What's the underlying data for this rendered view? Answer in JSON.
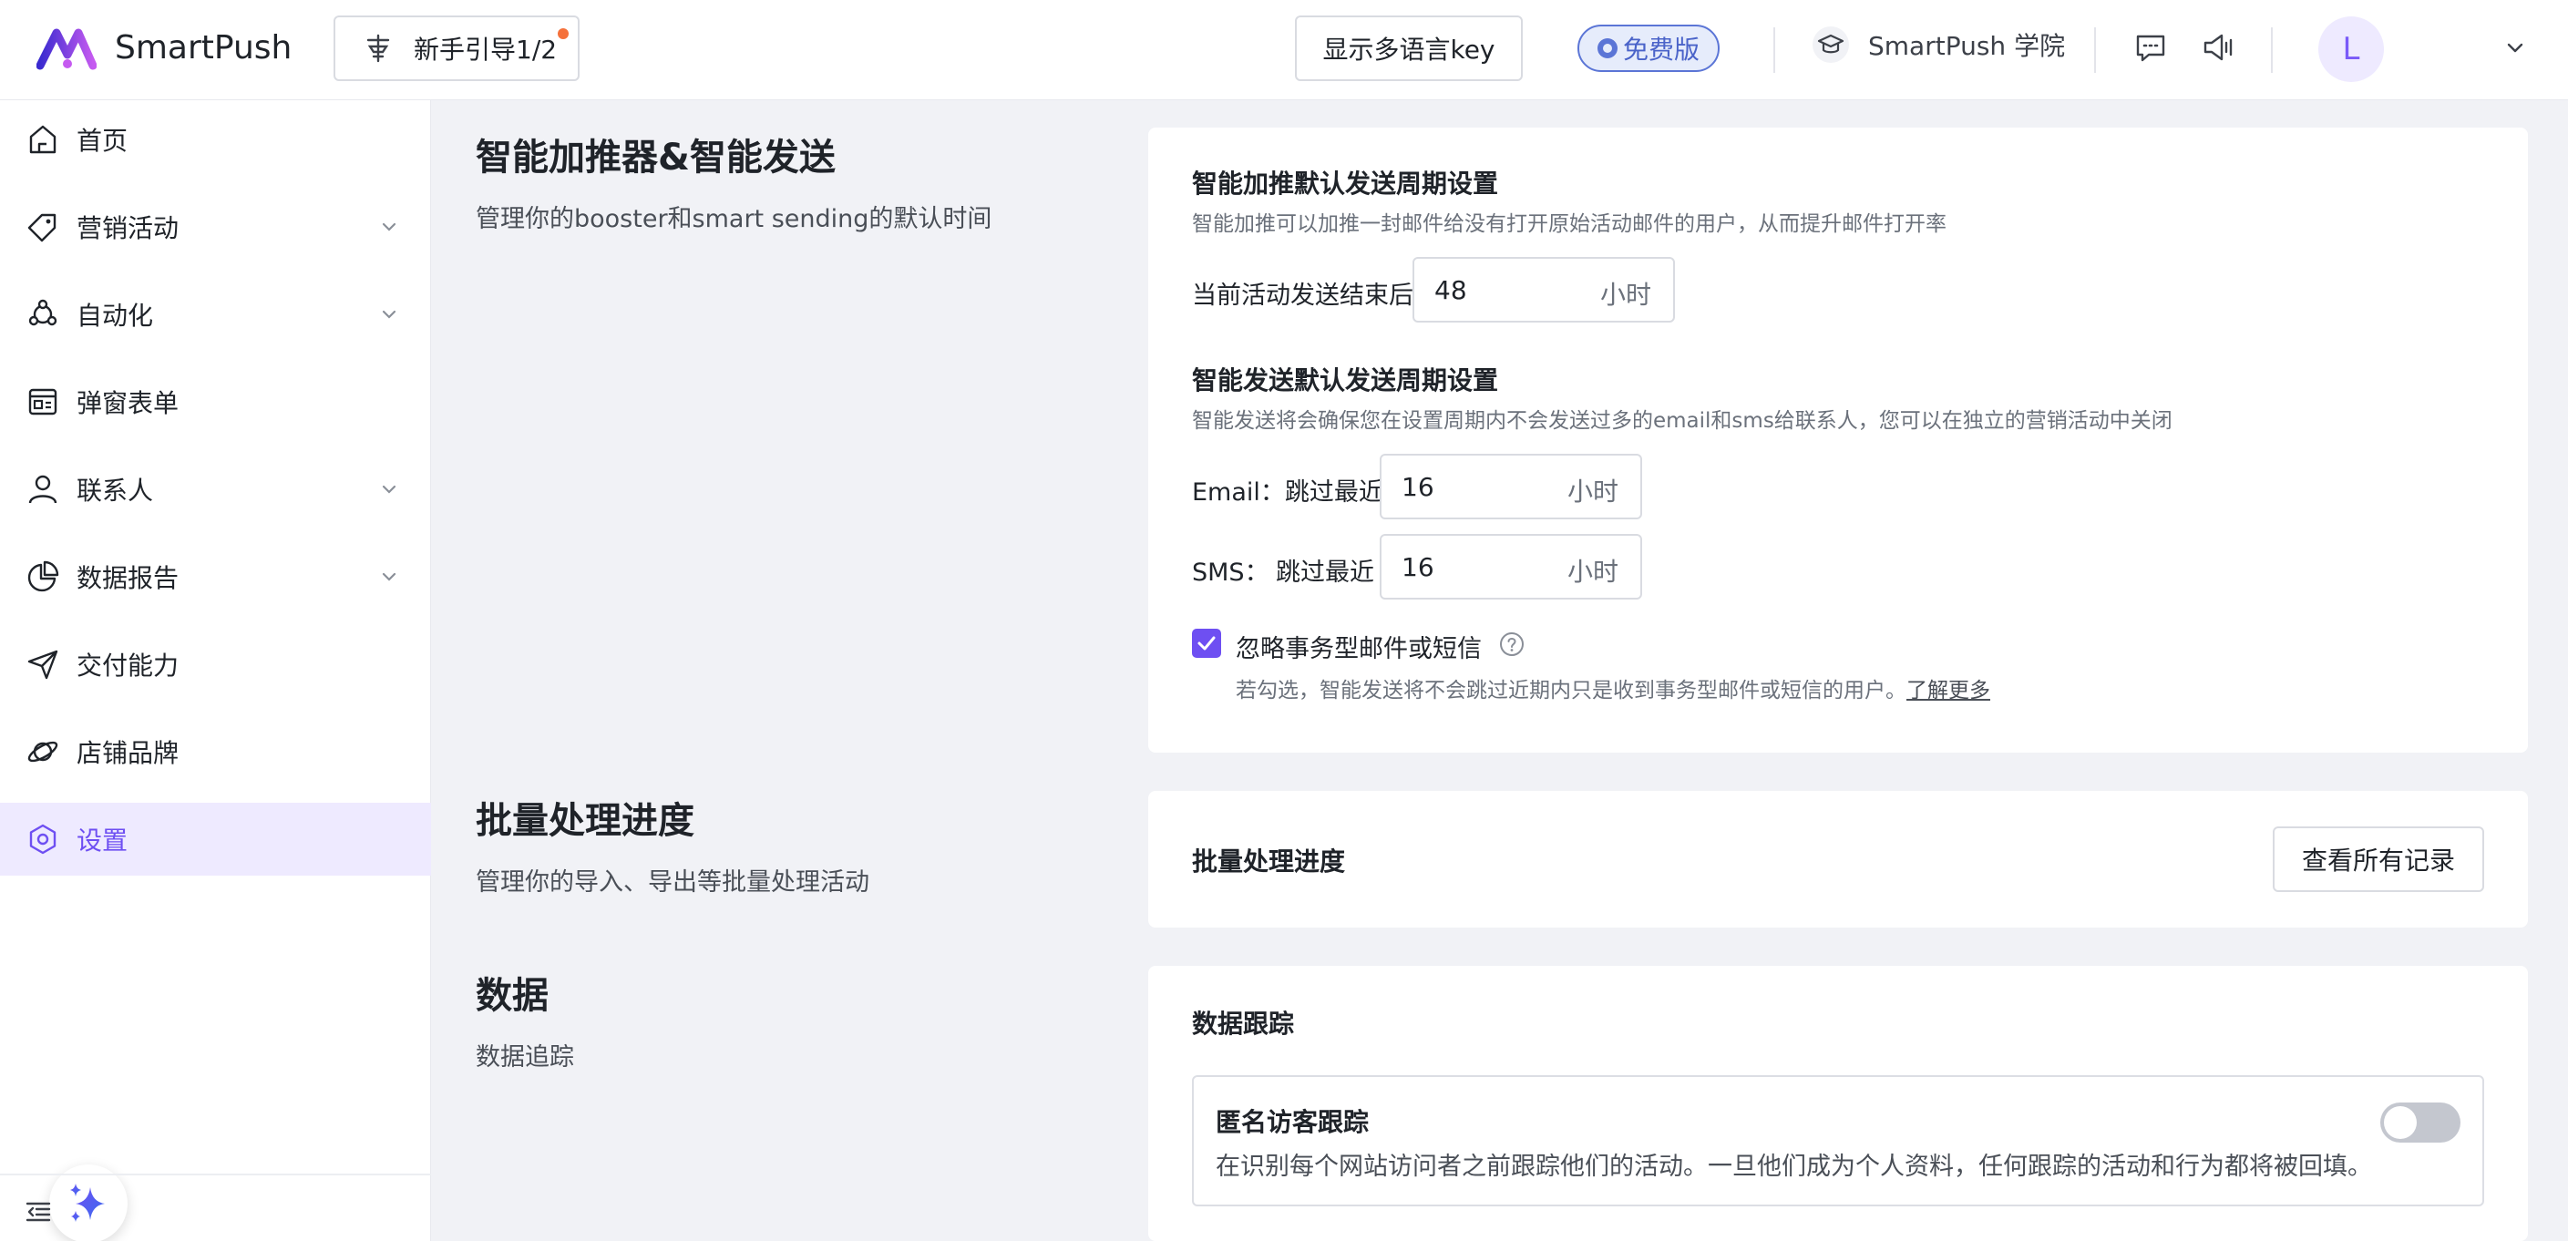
{
  "header": {
    "brand": "SmartPush",
    "guide_label": "新手引导1/2",
    "lang_key_label": "显示多语言key",
    "plan_badge": "免费版",
    "academy_label": "SmartPush 学院",
    "avatar_letter": "L"
  },
  "sidebar": {
    "items": [
      {
        "label": "首页",
        "icon": "home-icon"
      },
      {
        "label": "营销活动",
        "icon": "tag-icon",
        "expandable": true
      },
      {
        "label": "自动化",
        "icon": "automation-icon",
        "expandable": true
      },
      {
        "label": "弹窗表单",
        "icon": "form-icon"
      },
      {
        "label": "联系人",
        "icon": "user-icon",
        "expandable": true
      },
      {
        "label": "数据报告",
        "icon": "pie-chart-icon",
        "expandable": true
      },
      {
        "label": "交付能力",
        "icon": "send-icon"
      },
      {
        "label": "店铺品牌",
        "icon": "brand-icon"
      },
      {
        "label": "设置",
        "icon": "settings-icon",
        "active": true
      }
    ]
  },
  "smart": {
    "title": "智能加推器&智能发送",
    "desc": "管理你的booster和smart sending的默认时间",
    "booster_heading": "智能加推默认发送周期设置",
    "booster_hint": "智能加推可以加推一封邮件给没有打开原始活动邮件的用户，从而提升邮件打开率",
    "booster_label": "当前活动发送结束后",
    "booster_value": "48",
    "unit": "小时",
    "sending_heading": "智能发送默认发送周期设置",
    "sending_hint": "智能发送将会确保您在设置周期内不会发送过多的email和sms给联系人，您可以在独立的营销活动中关闭",
    "email_label": "Email：跳过最近",
    "email_value": "16",
    "sms_label": "SMS：",
    "sms_skip": "跳过最近",
    "sms_value": "16",
    "ignore_label": "忽略事务型邮件或短信",
    "ignore_checked": true,
    "ignore_hint": "若勾选，智能发送将不会跳过近期内只是收到事务型邮件或短信的用户。",
    "learn_more": "了解更多"
  },
  "batch": {
    "title": "批量处理进度",
    "desc": "管理你的导入、导出等批量处理活动",
    "card_label": "批量处理进度",
    "view_all": "查看所有记录"
  },
  "data_section": {
    "title": "数据",
    "desc": "数据追踪",
    "card_heading": "数据跟踪",
    "anon_title": "匿名访客跟踪",
    "anon_desc": "在识别每个网站访问者之前跟踪他们的活动。一旦他们成为个人资料，任何跟踪的活动和行为都将被回填。",
    "anon_enabled": false
  },
  "colors": {
    "accent": "#6e4ff2",
    "badge_blue": "#5b75d6",
    "guide_dot": "#f5713b"
  }
}
